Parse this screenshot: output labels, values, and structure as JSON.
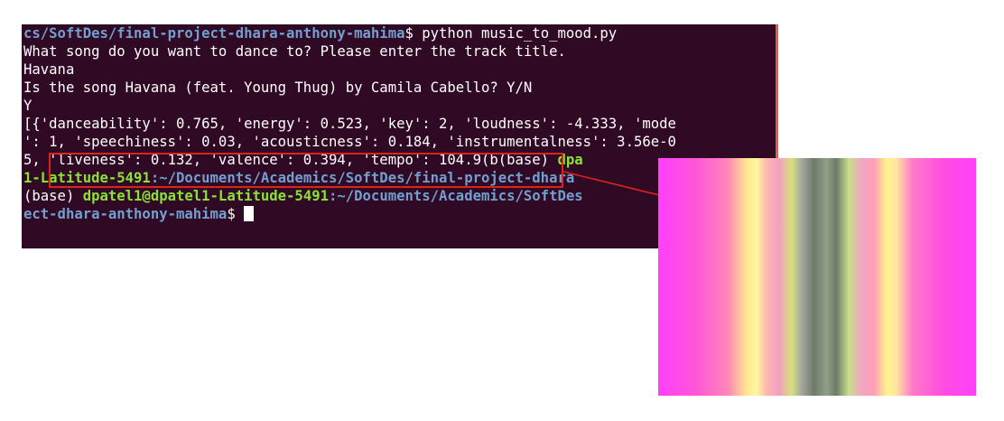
{
  "terminal": {
    "line1_path": "cs/SoftDes/final-project-dhara-anthony-mahima",
    "line1_cmd": "$ python music_to_mood.py",
    "line2": "What song do you want to dance to? Please enter the track title.",
    "line3": "Havana",
    "line4": "Is the song Havana (feat. Young Thug) by Camila Cabello? Y/N",
    "line5": "Y",
    "line6": "[{'danceability': 0.765, 'energy': 0.523, 'key': 2, 'loudness': -4.333, 'mode",
    "line7": "': 1, 'speechiness': 0.03, 'acousticness': 0.184, 'instrumentalness': 3.56e-0",
    "line8_text": "5, 'liveness': 0.132, 'valence': 0.394, 'tempo': 104.9(b(base) ",
    "line8_user": "dpa",
    "line9_user": "1-Latitude-5491",
    "line9_path": ":~/Documents/Academics/SoftDes/final-project-dhara",
    "line10_prefix": "(base) ",
    "line10_user": "dpatel1@dpatel1-Latitude-5491",
    "line10_path": ":~/Documents/Academics/SoftDes",
    "line11_path": "ect-dhara-anthony-mahima",
    "line11_prompt": "$ "
  },
  "colors": {
    "terminal_bg": "#300a24",
    "prompt_user": "#8ae234",
    "prompt_path": "#729fcf",
    "highlight_box": "#d9251c"
  },
  "visualization": {
    "description_icon": "mood-color-bands-image"
  }
}
